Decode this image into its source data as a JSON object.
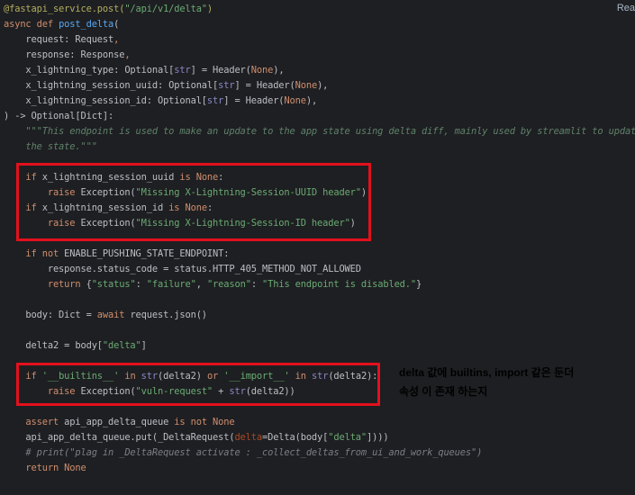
{
  "colors": {
    "background": "#1e1f22",
    "default": "#bcbec4",
    "keyword": "#cf8e6d",
    "string": "#6aab73",
    "comment": "#7a7e85",
    "docstring": "#5f826b",
    "decorator": "#b3ae60",
    "function": "#56a8f5",
    "builtin": "#8888c6",
    "number": "#2aacb8",
    "param_name": "#aa4926",
    "annotation_red": "#e3101d",
    "annotation_text": "#ffd400"
  },
  "header": {
    "reader_mode_label": "Rea"
  },
  "code_lines": [
    [
      [
        "@fastapi_service.post(",
        "decorator"
      ],
      [
        "\"/api/v1/delta\"",
        "string"
      ],
      [
        ")",
        "decorator"
      ]
    ],
    [
      [
        "async def ",
        "keyword"
      ],
      [
        "post_delta",
        "function"
      ],
      [
        "(",
        "default"
      ]
    ],
    [
      [
        "    request: Request",
        "default"
      ],
      [
        ",",
        "keyword"
      ]
    ],
    [
      [
        "    response: Response",
        "default"
      ],
      [
        ",",
        "keyword"
      ]
    ],
    [
      [
        "    x_lightning_type: Optional[",
        "default"
      ],
      [
        "str",
        "builtin"
      ],
      [
        "] = Header(",
        "default"
      ],
      [
        "None",
        "keyword"
      ],
      [
        "),",
        "default"
      ]
    ],
    [
      [
        "    x_lightning_session_uuid: Optional[",
        "default"
      ],
      [
        "str",
        "builtin"
      ],
      [
        "] = Header(",
        "default"
      ],
      [
        "None",
        "keyword"
      ],
      [
        "),",
        "default"
      ]
    ],
    [
      [
        "    x_lightning_session_id: Optional[",
        "default"
      ],
      [
        "str",
        "builtin"
      ],
      [
        "] = Header(",
        "default"
      ],
      [
        "None",
        "keyword"
      ],
      [
        "),",
        "default"
      ]
    ],
    [
      [
        ") -> Optional[Dict]:",
        "default"
      ]
    ],
    [
      [
        "    \"\"\"This endpoint is used to make an update to the app state using delta diff, mainly used by streamlit to update",
        "docstring"
      ]
    ],
    [
      [
        "    the state.\"\"\"",
        "docstring"
      ]
    ],
    [],
    [
      [
        "    if ",
        "keyword"
      ],
      [
        "x_lightning_session_uuid ",
        "default"
      ],
      [
        "is None",
        "keyword"
      ],
      [
        ":",
        "default"
      ]
    ],
    [
      [
        "        raise ",
        "keyword"
      ],
      [
        "Exception(",
        "default"
      ],
      [
        "\"Missing X-Lightning-Session-UUID header\"",
        "string"
      ],
      [
        ")",
        "default"
      ]
    ],
    [
      [
        "    if ",
        "keyword"
      ],
      [
        "x_lightning_session_id ",
        "default"
      ],
      [
        "is None",
        "keyword"
      ],
      [
        ":",
        "default"
      ]
    ],
    [
      [
        "        raise ",
        "keyword"
      ],
      [
        "Exception(",
        "default"
      ],
      [
        "\"Missing X-Lightning-Session-ID header\"",
        "string"
      ],
      [
        ")",
        "default"
      ]
    ],
    [],
    [
      [
        "    if not ",
        "keyword"
      ],
      [
        "ENABLE_PUSHING_STATE_ENDPOINT:",
        "default"
      ]
    ],
    [
      [
        "        response.status_code = status.HTTP_405_METHOD_NOT_ALLOWED",
        "default"
      ]
    ],
    [
      [
        "        return ",
        "keyword"
      ],
      [
        "{",
        "default"
      ],
      [
        "\"status\"",
        "string"
      ],
      [
        ": ",
        "default"
      ],
      [
        "\"failure\"",
        "string"
      ],
      [
        ", ",
        "default"
      ],
      [
        "\"reason\"",
        "string"
      ],
      [
        ": ",
        "default"
      ],
      [
        "\"This endpoint is disabled.\"",
        "string"
      ],
      [
        "}",
        "default"
      ]
    ],
    [],
    [
      [
        "    body: Dict = ",
        "default"
      ],
      [
        "await ",
        "keyword"
      ],
      [
        "request.json()",
        "default"
      ]
    ],
    [],
    [
      [
        "    delta2 = body[",
        "default"
      ],
      [
        "\"delta\"",
        "string"
      ],
      [
        "]",
        "default"
      ]
    ],
    [],
    [
      [
        "    if ",
        "keyword"
      ],
      [
        "'__builtins__'",
        "string"
      ],
      [
        " in ",
        "keyword"
      ],
      [
        "str",
        "builtin"
      ],
      [
        "(delta2) ",
        "default"
      ],
      [
        "or ",
        "keyword"
      ],
      [
        "'__import__'",
        "string"
      ],
      [
        " in ",
        "keyword"
      ],
      [
        "str",
        "builtin"
      ],
      [
        "(delta2):",
        "default"
      ]
    ],
    [
      [
        "        raise ",
        "keyword"
      ],
      [
        "Exception(",
        "default"
      ],
      [
        "\"vuln-request\"",
        "string"
      ],
      [
        " + ",
        "default"
      ],
      [
        "str",
        "builtin"
      ],
      [
        "(delta2))",
        "default"
      ]
    ],
    [],
    [
      [
        "    assert ",
        "keyword"
      ],
      [
        "api_app_delta_queue ",
        "default"
      ],
      [
        "is not None",
        "keyword"
      ]
    ],
    [
      [
        "    api_app_delta_queue.put(_DeltaRequest(",
        "default"
      ],
      [
        "delta",
        "param_name"
      ],
      [
        "=Delta(body[",
        "default"
      ],
      [
        "\"delta\"",
        "string"
      ],
      [
        "])))",
        "default"
      ]
    ],
    [
      [
        "    # print(\"plag in _DeltaRequest activate : _collect_deltas_from_ui_and_work_queues\")",
        "comment"
      ]
    ],
    [
      [
        "    return None",
        "keyword"
      ]
    ]
  ],
  "annotation": {
    "line1": "delta 값에 builtins, import 같은 둔더",
    "line2": "속성 이 존재 하는지"
  }
}
